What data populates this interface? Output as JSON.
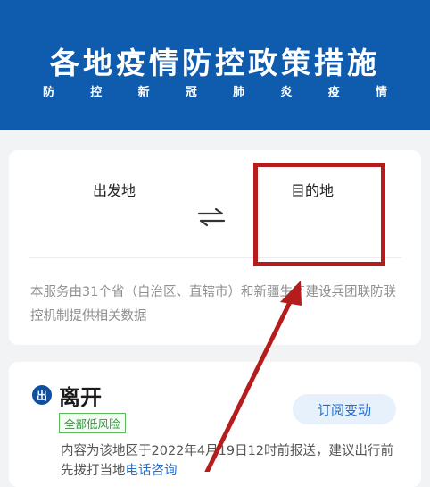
{
  "header": {
    "title": "各地疫情防控政策措施",
    "subtitle_chars": [
      "防",
      "控",
      "新",
      "冠",
      "肺",
      "炎",
      "疫",
      "情"
    ]
  },
  "route": {
    "origin_label": "出发地",
    "destination_label": "目的地",
    "swap_icon": "swap-arrows-icon",
    "note": "本服务由31个省（自治区、直辖市）和新疆生产建设兵团联防联控机制提供相关数据"
  },
  "leave": {
    "badge": "出",
    "title": "离开",
    "risk_tag": "全部低风险",
    "subscribe_label": "订阅变动",
    "note_prefix": "内容为该地区于2022年4月19日12时前报送，建议出行前先拨打当地",
    "note_link": "电话咨询"
  },
  "colors": {
    "header_bg": "#0f5cae",
    "annotation_red": "#b51c1c",
    "accent_blue": "#1f6fd1",
    "risk_green": "#2e9a3a"
  }
}
